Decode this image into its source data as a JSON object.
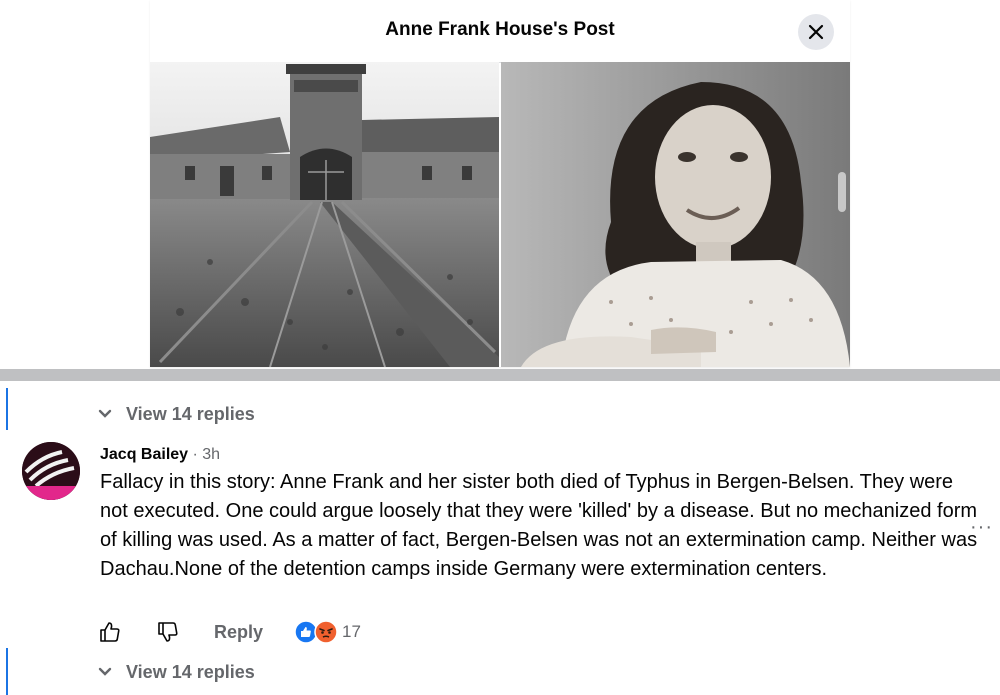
{
  "modal": {
    "title": "Anne Frank House's Post",
    "close_icon": "close-icon",
    "photos": [
      "camp-gate-railway-photo",
      "anne-frank-portrait-photo"
    ]
  },
  "thread_previous": {
    "view_replies": "View 14 replies"
  },
  "comment": {
    "author": "Jacq Bailey",
    "separator": " · ",
    "time": "3h",
    "text": "Fallacy in this story: Anne Frank and her sister both died of Typhus in Bergen-Belsen. They were not executed. One could argue loosely that they were 'killed' by a disease. But no mechanized form of killing was used. As a matter of fact, Bergen-Belsen was not an extermination camp. Neither was Dachau.None of the detention camps inside Germany were extermination centers.",
    "more_label": "···",
    "actions": {
      "reply": "Reply",
      "reaction_count": "17",
      "like_icon": "thumbs-up-icon",
      "dislike_icon": "thumbs-down-icon",
      "reactions": [
        "like",
        "angry"
      ]
    },
    "view_replies": "View 14 replies"
  },
  "colors": {
    "accent": "#1b74e4",
    "secondary_text": "#65676b",
    "primary_text": "#050505"
  }
}
